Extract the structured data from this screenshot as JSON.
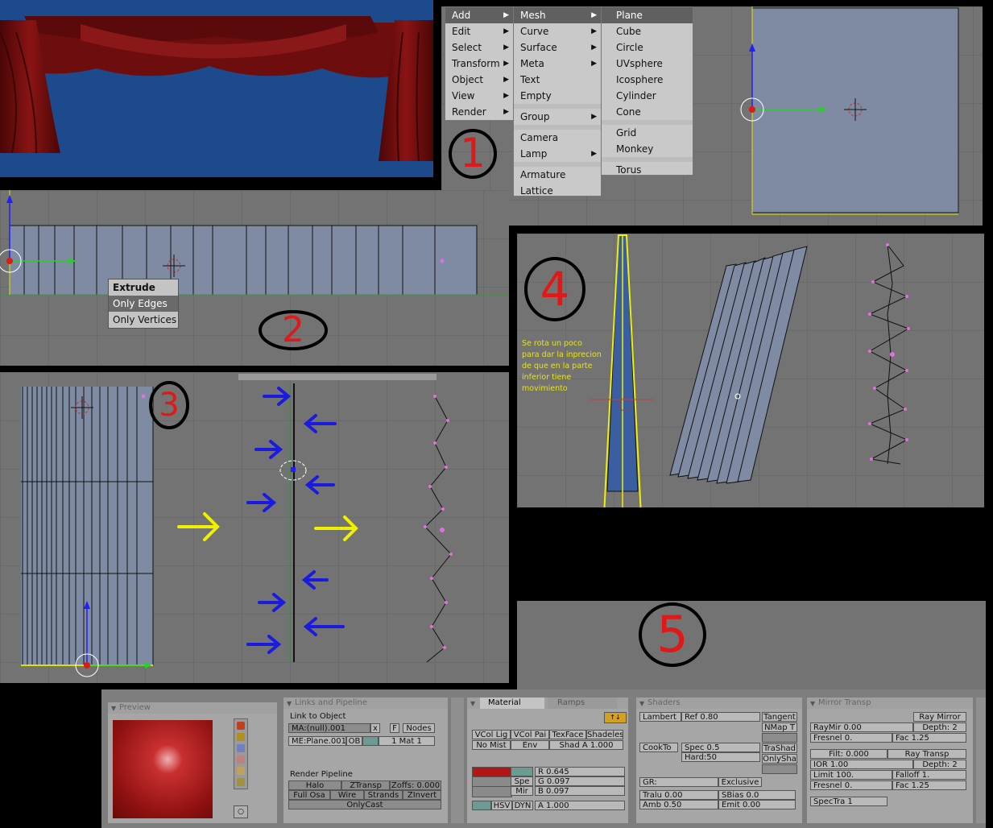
{
  "colors": {
    "viewport_bg": "#737373",
    "viewport_grid": "#6a6a6a",
    "render_bg": "#1c4a8c",
    "curtain": "#7a1010",
    "menu_bg": "#c9c9c9",
    "menu_selected": "#606060",
    "panel_bg": "#a6a6a6",
    "mesh_fill": "#7f8aa3",
    "vertex": "#e070e0",
    "annotation_circle": "#000000",
    "annotation_number": "#e01818",
    "arrow_blue": "#1a1ae0",
    "arrow_yellow": "#f0f000"
  },
  "add_menu": {
    "items": [
      {
        "label": "Add",
        "submenu": true,
        "selected": true
      },
      {
        "label": "Edit",
        "submenu": true
      },
      {
        "label": "Select",
        "submenu": true
      },
      {
        "label": "Transform",
        "submenu": true
      },
      {
        "label": "Object",
        "submenu": true
      },
      {
        "label": "View",
        "submenu": true
      },
      {
        "label": "Render",
        "submenu": true
      }
    ]
  },
  "add_submenu": {
    "items": [
      {
        "label": "Mesh",
        "submenu": true,
        "selected": true
      },
      {
        "label": "Curve",
        "submenu": true
      },
      {
        "label": "Surface",
        "submenu": true
      },
      {
        "label": "Meta",
        "submenu": true
      },
      {
        "label": "Text"
      },
      {
        "label": "Empty"
      },
      {
        "label": "Group",
        "submenu": true
      },
      {
        "label": "Camera"
      },
      {
        "label": "Lamp",
        "submenu": true
      },
      {
        "label": "Armature"
      },
      {
        "label": "Lattice"
      }
    ]
  },
  "mesh_submenu": {
    "items": [
      {
        "label": "Plane",
        "selected": true
      },
      {
        "label": "Cube"
      },
      {
        "label": "Circle"
      },
      {
        "label": "UVsphere"
      },
      {
        "label": "Icosphere"
      },
      {
        "label": "Cylinder"
      },
      {
        "label": "Cone"
      },
      {
        "label": "Grid"
      },
      {
        "label": "Monkey"
      },
      {
        "label": "Torus"
      }
    ]
  },
  "extrude_popup": {
    "title": "Extrude",
    "options": [
      "Only Edges",
      "Only Vertices"
    ]
  },
  "step_labels": [
    "1",
    "2",
    "3",
    "4",
    "5"
  ],
  "note_step4": [
    "Se rota un poco",
    "para dar la inprecion",
    "de que en la parte",
    "inferior tiene",
    "movimiento"
  ],
  "preview_panel": {
    "title": "Preview"
  },
  "links_panel": {
    "title": "Links and Pipeline",
    "link_to_object": "Link to Object",
    "ma_field": "MA:(null).001",
    "x_btn": "x",
    "f_btn": "F",
    "nodes": "Nodes",
    "me_field": "ME:Plane.001",
    "ob": "OB",
    "mat": "1 Mat 1",
    "render_pipeline": "Render Pipeline",
    "halo": "Halo",
    "ztransp": "ZTransp",
    "zoffs": "Zoffs: 0.000",
    "full_osa": "Full Osa",
    "wire": "Wire",
    "strands": "Strands",
    "zinvert": "ZInvert",
    "onlycast": "OnlyCast"
  },
  "material_panel": {
    "tab_material": "Material",
    "tab_ramps": "Ramps",
    "vcol_light": "VCol Lig",
    "vcol_paint": "VCol Pai",
    "texface": "TexFace",
    "shadeless": "Shadeles",
    "no_mist": "No Mist",
    "env": "Env",
    "shad_a": "Shad A 1.000",
    "spe": "Spe",
    "mir": "Mir",
    "r": "R 0.645",
    "g": "G 0.097",
    "b": "B 0.097",
    "hsv": "HSV",
    "dyn": "DYN",
    "a": "A 1.000",
    "color": "#b21717"
  },
  "shaders_panel": {
    "title": "Shaders",
    "lambert": "Lambert",
    "ref": "Ref   0.80",
    "tangent": "Tangent",
    "nmap": "NMap T",
    "cookto": "CookTo",
    "spec": "Spec 0.5",
    "hard": "Hard:50",
    "trashad": "TraShad",
    "onlysha": "OnlySha",
    "gr": "GR:",
    "exclusive": "Exclusive",
    "tralu": "Tralu 0.00",
    "sbias": "SBias 0.0",
    "amb": "Amb 0.50",
    "emit": "Emit 0.00"
  },
  "mirror_panel": {
    "title": "Mirror Transp",
    "ray_mirror": "Ray Mirror",
    "raymir": "RayMir 0.00",
    "depth1": "Depth: 2",
    "fresnel1": "Fresnel 0.",
    "fac1": "Fac 1.25",
    "filt": "Filt: 0.000",
    "ray_transp": "Ray Transp",
    "ior": "IOR 1.00",
    "depth2": "Depth: 2",
    "limit": "Limit 100.",
    "falloff": "Falloff 1.",
    "fresnel2": "Fresnel 0.",
    "fac2": "Fac 1.25",
    "spectra": "SpecTra 1"
  }
}
